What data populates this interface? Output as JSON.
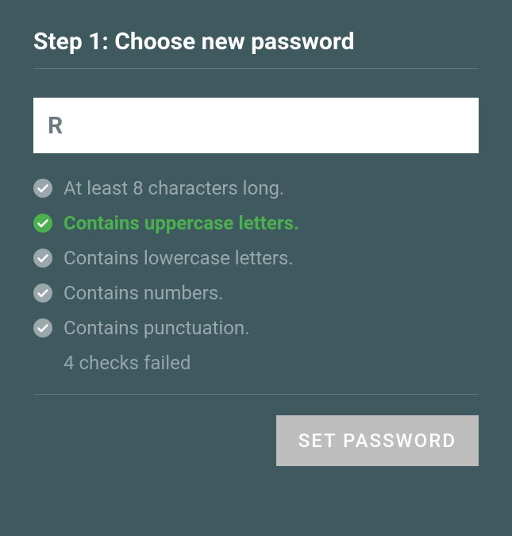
{
  "title": "Step 1: Choose new password",
  "password_value": "R",
  "requirements": [
    {
      "label": "At least 8 characters long.",
      "met": false
    },
    {
      "label": "Contains uppercase letters.",
      "met": true
    },
    {
      "label": "Contains lowercase letters.",
      "met": false
    },
    {
      "label": "Contains numbers.",
      "met": false
    },
    {
      "label": "Contains punctuation.",
      "met": false
    }
  ],
  "summary": "4 checks failed",
  "button_label": "SET PASSWORD"
}
